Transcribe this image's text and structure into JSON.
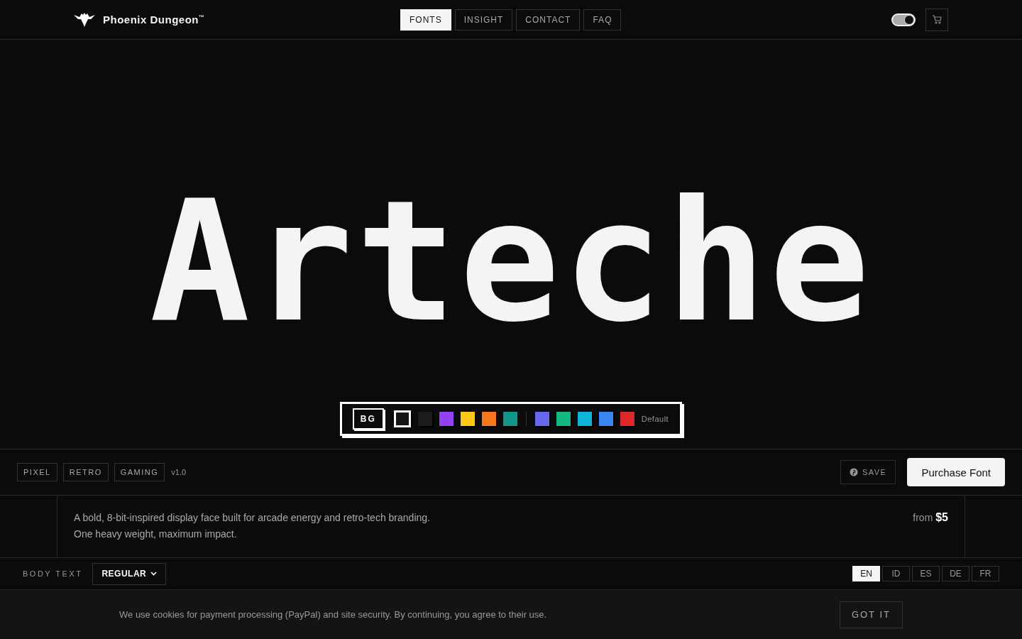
{
  "header": {
    "brand": "Phoenix Dungeon",
    "brand_mark": "™",
    "nav": [
      {
        "label": "FONTS",
        "selected": true
      },
      {
        "label": "INSIGHT",
        "selected": false
      },
      {
        "label": "CONTACT",
        "selected": false
      },
      {
        "label": "FAQ",
        "selected": false
      }
    ],
    "theme_toggle": {
      "on": true
    }
  },
  "hero": {
    "specimen": "Arteche",
    "bg_label": "BG",
    "swatches": [
      {
        "color": "#151515",
        "selected": true
      },
      {
        "color": "#1c1c1c",
        "selected": false
      },
      {
        "color": "#9440f5",
        "selected": false
      },
      {
        "color": "#fac815",
        "selected": false
      },
      {
        "color": "#f7761c",
        "selected": false
      },
      {
        "color": "#129486",
        "selected": false
      },
      {
        "color": "#6867ef",
        "selected": false,
        "group_start": true
      },
      {
        "color": "#14b982",
        "selected": false
      },
      {
        "color": "#0cb5d6",
        "selected": false
      },
      {
        "color": "#3c86f4",
        "selected": false
      },
      {
        "color": "#dc2828",
        "selected": false
      }
    ],
    "default_label": "Default"
  },
  "tags": [
    "PIXEL",
    "RETRO",
    "GAMING"
  ],
  "version": "v1.0",
  "save_label": "SAVE",
  "purchase_label": "Purchase Font",
  "description": [
    "A bold, 8-bit-inspired display face built for arcade energy and retro-tech branding.",
    "One heavy weight, maximum impact."
  ],
  "price": "from **$5**",
  "body_text": {
    "label": "BODY TEXT",
    "weight": "REGULAR",
    "languages": [
      {
        "label": "EN",
        "selected": true
      },
      {
        "label": "ID",
        "selected": false
      },
      {
        "label": "ES",
        "selected": false
      },
      {
        "label": "DE",
        "selected": false
      },
      {
        "label": "FR",
        "selected": false
      }
    ]
  },
  "cookie": {
    "message": "We use cookies for payment processing (PayPal) and site security. By continuing, you agree to their use.",
    "button": "GOT IT"
  }
}
